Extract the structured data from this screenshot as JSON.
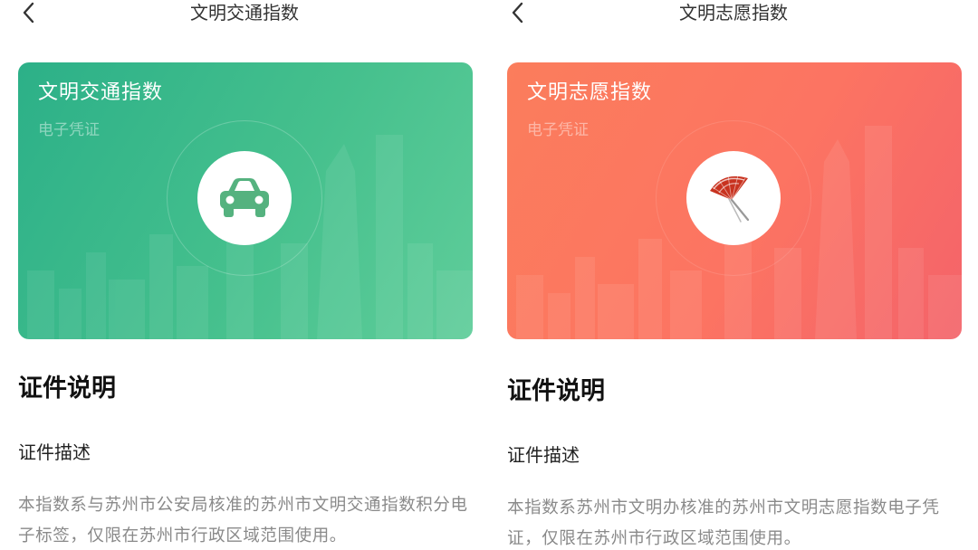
{
  "screens": [
    {
      "nav_title": "文明交通指数",
      "card": {
        "title": "文明交通指数",
        "subtitle": "电子凭证",
        "icon": "car-icon",
        "color": "#3bb88b"
      },
      "section_title": "证件说明",
      "field_label": "证件描述",
      "description": "本指数系与苏州市公安局核准的苏州市文明交通指数积分电子标签，仅限在苏州市行政区域范围使用。"
    },
    {
      "nav_title": "文明志愿指数",
      "card": {
        "title": "文明志愿指数",
        "subtitle": "电子凭证",
        "icon": "folding-fan-icon",
        "color": "#fb7061"
      },
      "section_title": "证件说明",
      "field_label": "证件描述",
      "description": "本指数系苏州市文明办核准的苏州市文明志愿指数电子凭证，仅限在苏州市行政区域范围使用。"
    }
  ],
  "colors": {
    "green_icon": "#55b27f",
    "fan_red": "#c8321f"
  }
}
